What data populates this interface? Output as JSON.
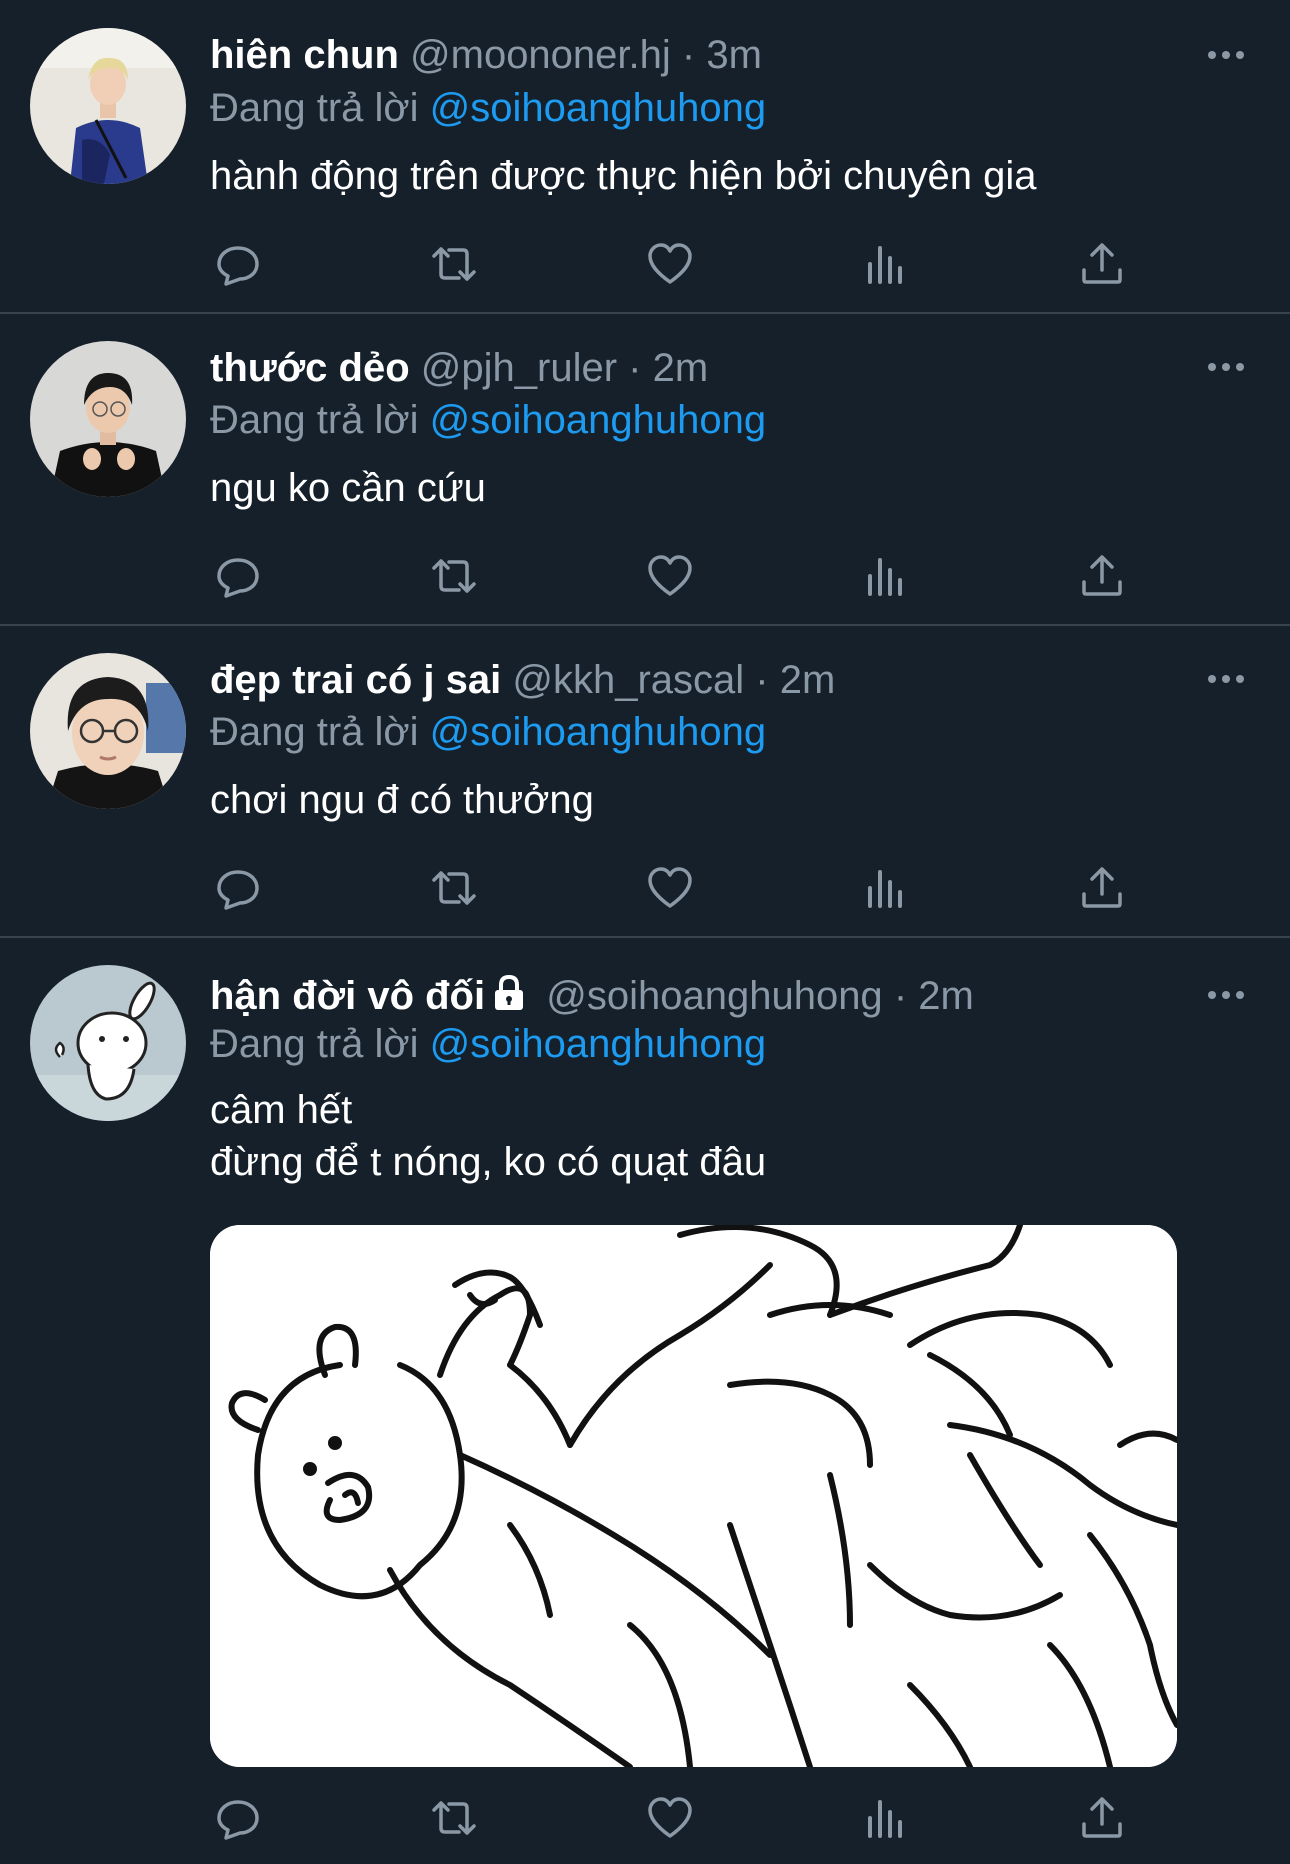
{
  "tweets": [
    {
      "name": "hiên chun",
      "handle": "@moononer.hj",
      "sep": "·",
      "time": "3m",
      "reply_label": "Đang trả lời",
      "reply_to": "@soihoanghuhong",
      "lines": [
        "hành động trên được thực hiện bởi chuyên gia"
      ]
    },
    {
      "name": "thước dẻo",
      "handle": "@pjh_ruler",
      "sep": "·",
      "time": "2m",
      "reply_label": "Đang trả lời",
      "reply_to": "@soihoanghuhong",
      "lines": [
        "ngu ko cần cứu"
      ]
    },
    {
      "name": "đẹp trai có j sai",
      "handle": "@kkh_rascal",
      "sep": "·",
      "time": "2m",
      "reply_label": "Đang trả lời",
      "reply_to": "@soihoanghuhong",
      "lines": [
        "chơi ngu đ có thưởng"
      ]
    },
    {
      "name": "hận đời vô đối",
      "handle": "@soihoanghuhong",
      "sep": "·",
      "time": "2m",
      "reply_label": "Đang trả lời",
      "reply_to": "@soihoanghuhong",
      "locked": true,
      "lines": [
        "câm hết",
        "đừng để t nóng, ko có quạt đâu"
      ],
      "media": "bear-meme-image"
    }
  ],
  "action_icons": [
    "reply-icon",
    "retweet-icon",
    "like-icon",
    "views-icon",
    "share-icon"
  ],
  "colors": {
    "background": "#15202b",
    "divider": "#38444d",
    "secondary_text": "#8b98a5",
    "mention": "#1d9bf0"
  }
}
